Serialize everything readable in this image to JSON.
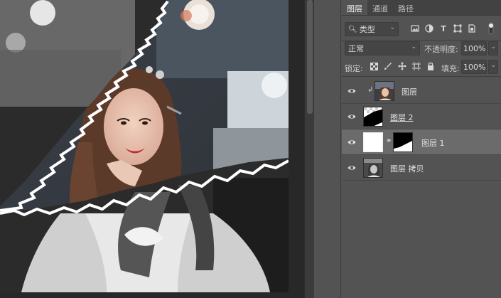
{
  "tabs": [
    {
      "label": "图层",
      "active": true
    },
    {
      "label": "通道",
      "active": false
    },
    {
      "label": "路径",
      "active": false
    }
  ],
  "filter": {
    "kind_label": "类型"
  },
  "blend": {
    "mode": "正常",
    "opacity_label": "不透明度:",
    "opacity_value": "100%"
  },
  "lock": {
    "label": "锁定:",
    "fill_label": "填充:",
    "fill_value": "100%"
  },
  "layers": [
    {
      "name": "图层",
      "clipped": true
    },
    {
      "name": "图层 2",
      "underlined": true
    },
    {
      "name": "图层 1",
      "selected": true,
      "has_mask": true
    },
    {
      "name": "图层 拷贝"
    }
  ],
  "colors": {
    "panel": "#535353",
    "selected_row": "#6b6b6b",
    "tabbar": "#424242",
    "canvas_bg": "#282828"
  }
}
